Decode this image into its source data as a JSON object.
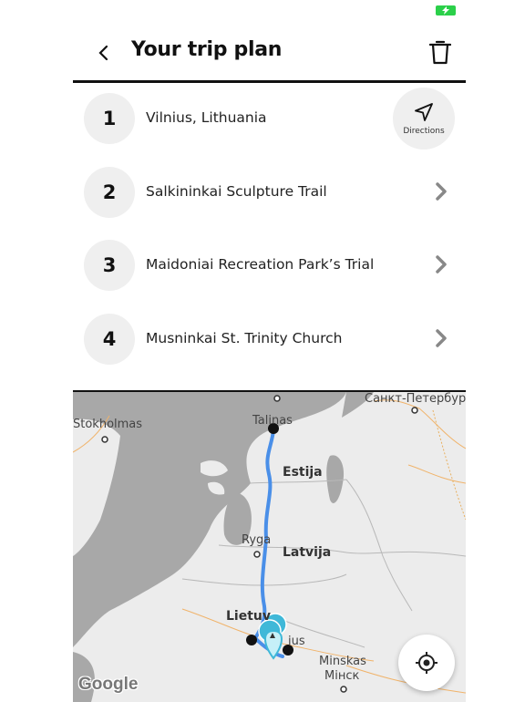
{
  "header": {
    "title": "Your trip plan"
  },
  "stops": [
    {
      "number": "1",
      "name": "Vilnius, Lithuania"
    },
    {
      "number": "2",
      "name": "Salkininkai Sculpture Trail"
    },
    {
      "number": "3",
      "name": "Maidoniai Recreation Park’s Trial"
    },
    {
      "number": "4",
      "name": "Musninkai St. Trinity Church"
    }
  ],
  "directions": {
    "label": "Directions"
  },
  "map": {
    "labels": {
      "stockholm": "Stokholmas",
      "tallinn": "Talinas",
      "stpetersburg": "Санкт-Петербург",
      "estonia": "Estija",
      "riga": "Ryga",
      "latvia": "Latvija",
      "lithuania": "Lietuv",
      "vilnius": "ius",
      "minsk_lt": "Minskas",
      "minsk_ru": "Мінск"
    },
    "attribution": "Google"
  },
  "colors": {
    "route": "#4a8fe8",
    "battery": "#2bd04a",
    "marker": "#3fb8d8"
  }
}
